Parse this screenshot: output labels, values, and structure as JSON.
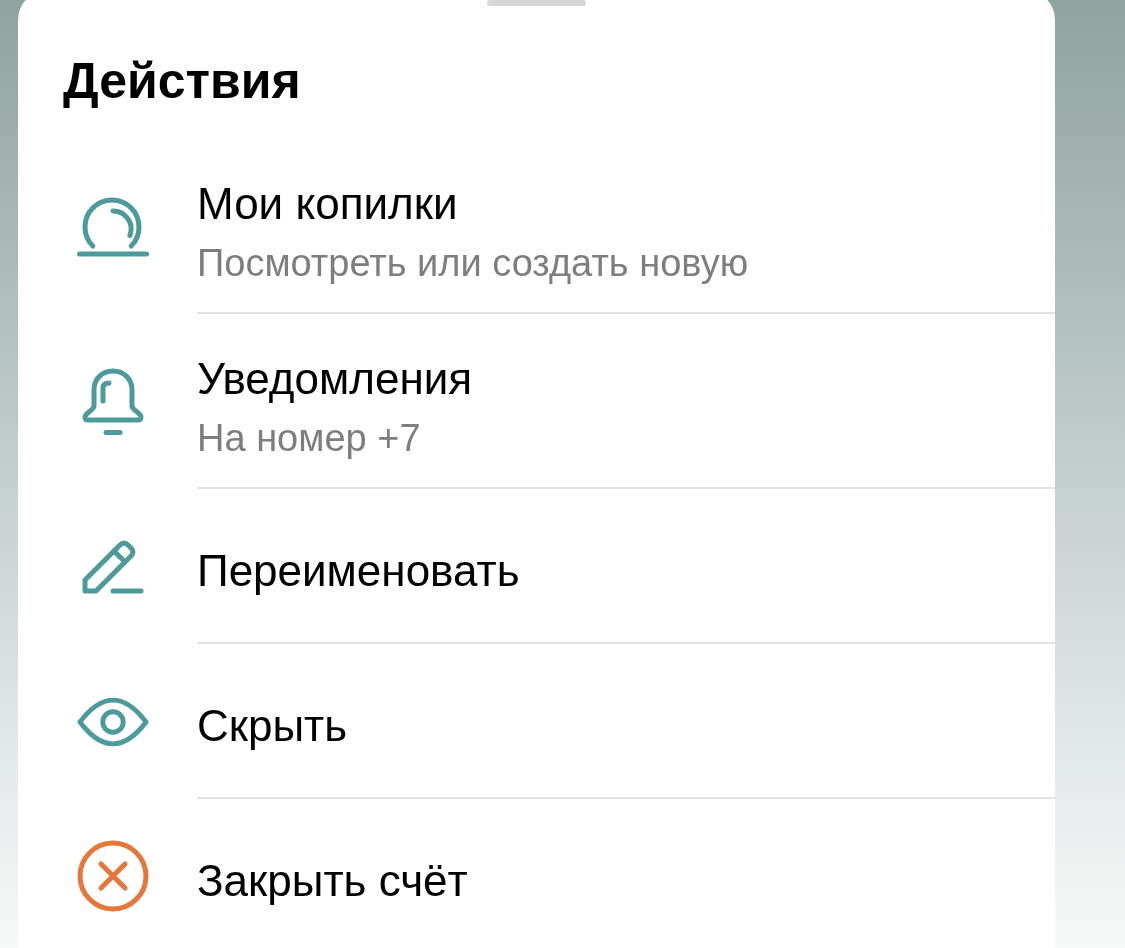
{
  "sheet": {
    "title": "Действия",
    "items": [
      {
        "kind": "savings",
        "color": "#4c9a9c",
        "title": "Мои копилки",
        "subtitle": "Посмотреть или создать новую"
      },
      {
        "kind": "bell",
        "color": "#4c9a9c",
        "title": "Уведомления",
        "subtitle": "На номер +7"
      },
      {
        "kind": "pencil",
        "color": "#4c9a9c",
        "title": "Переименовать"
      },
      {
        "kind": "eye",
        "color": "#4c9a9c",
        "title": "Скрыть"
      },
      {
        "kind": "close",
        "color": "#e5773a",
        "title": "Закрыть счёт"
      }
    ]
  }
}
